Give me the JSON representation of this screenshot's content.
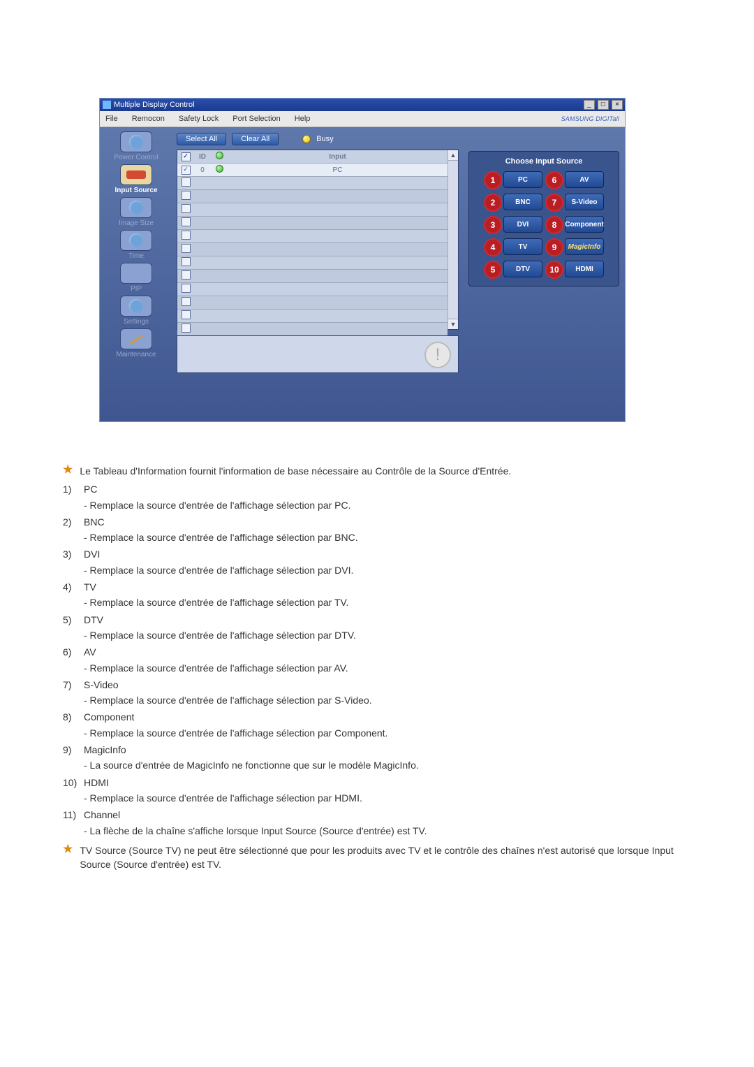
{
  "window": {
    "title": "Multiple Display Control",
    "menu": [
      "File",
      "Remocon",
      "Safety Lock",
      "Port Selection",
      "Help"
    ],
    "brand": "SAMSUNG DIGITall"
  },
  "sidebar": {
    "items": [
      {
        "label": "Power Control"
      },
      {
        "label": "Input Source",
        "active": true
      },
      {
        "label": "Image Size"
      },
      {
        "label": "Time"
      },
      {
        "label": "PIP"
      },
      {
        "label": "Settings"
      },
      {
        "label": "Maintenance"
      }
    ]
  },
  "toolbar": {
    "select_all": "Select All",
    "clear_all": "Clear All",
    "busy": "Busy"
  },
  "grid": {
    "headers": {
      "id": "ID",
      "input": "Input"
    },
    "rows": [
      {
        "id": "0",
        "input": "PC",
        "checked": true,
        "on": true
      }
    ],
    "blank_rows": 12
  },
  "choose_panel": {
    "title": "Choose Input Source",
    "sources": [
      {
        "n": "1",
        "label": "PC"
      },
      {
        "n": "6",
        "label": "AV"
      },
      {
        "n": "2",
        "label": "BNC"
      },
      {
        "n": "7",
        "label": "S-Video"
      },
      {
        "n": "3",
        "label": "DVI"
      },
      {
        "n": "8",
        "label": "Component"
      },
      {
        "n": "4",
        "label": "TV"
      },
      {
        "n": "9",
        "label": "MagicInfo",
        "magic": true
      },
      {
        "n": "5",
        "label": "DTV"
      },
      {
        "n": "10",
        "label": "HDMI"
      }
    ]
  },
  "description": {
    "intro": "Le Tableau d'Information fournit l'information de base nécessaire au Contrôle de la Source d'Entrée.",
    "items": [
      {
        "num": "1)",
        "title": "PC",
        "sub": "- Remplace la source d'entrée de l'affichage sélection par PC."
      },
      {
        "num": "2)",
        "title": "BNC",
        "sub": "- Remplace la source d'entrée de l'affichage sélection par BNC."
      },
      {
        "num": "3)",
        "title": "DVI",
        "sub": "- Remplace la source d'entrée de l'affichage sélection par DVI."
      },
      {
        "num": "4)",
        "title": "TV",
        "sub": "- Remplace la source d'entrée de l'affichage sélection par TV."
      },
      {
        "num": "5)",
        "title": "DTV",
        "sub": "- Remplace la source d'entrée de l'affichage sélection par DTV."
      },
      {
        "num": "6)",
        "title": "AV",
        "sub": "- Remplace la source d'entrée de l'affichage sélection par AV."
      },
      {
        "num": "7)",
        "title": "S-Video",
        "sub": "- Remplace la source d'entrée de l'affichage sélection par S-Video."
      },
      {
        "num": "8)",
        "title": "Component",
        "sub": "- Remplace la source d'entrée de l'affichage sélection par Component."
      },
      {
        "num": "9)",
        "title": "MagicInfo",
        "sub": "- La source d'entrée de MagicInfo ne fonctionne que sur le modèle MagicInfo."
      },
      {
        "num": "10)",
        "title": "HDMI",
        "sub": "- Remplace la source d'entrée de l'affichage sélection par HDMI."
      },
      {
        "num": "11)",
        "title": "Channel",
        "sub": "- La flèche de la chaîne s'affiche lorsque Input Source (Source d'entrée) est TV."
      }
    ],
    "footnote": "TV Source (Source TV) ne peut être sélectionné que pour les produits avec TV et le contrôle des chaînes n'est autorisé que lorsque Input Source (Source d'entrée) est TV."
  }
}
